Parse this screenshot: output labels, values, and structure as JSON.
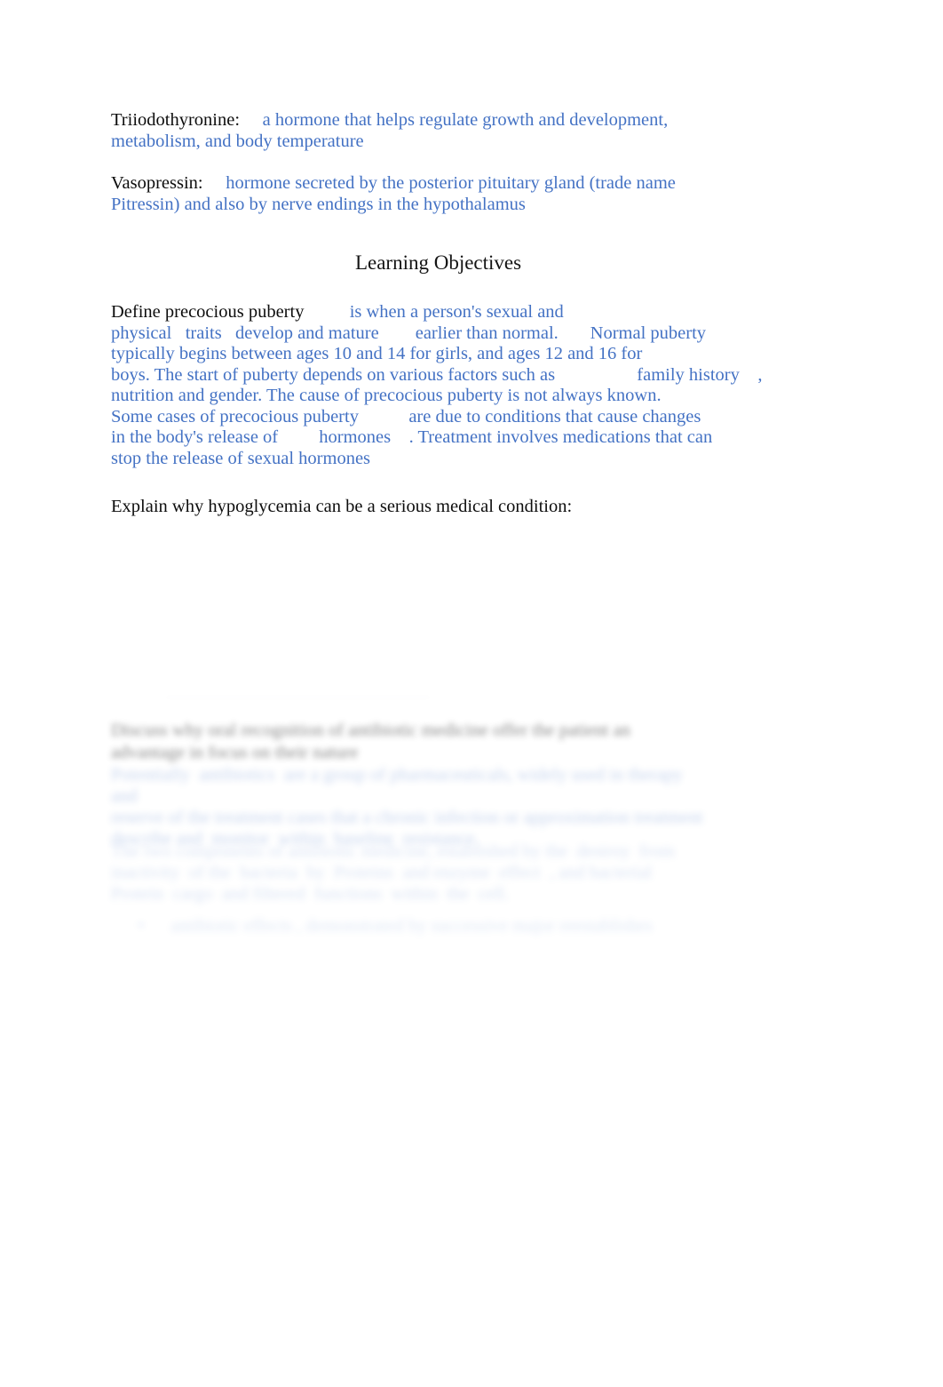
{
  "document": {
    "page_background": "#ffffff",
    "body_text_color": "#4472c4",
    "label_text_color": "#0d0d0d"
  },
  "glossary": [
    {
      "term": "Triiodothyronine:",
      "definition": "     a hormone that helps regulate growth and development,\nmetabolism, and body temperature"
    },
    {
      "term": "Vasopressin:",
      "definition": "     hormone secreted by the posterior pituitary gland (trade name\nPitressin) and also by nerve endings in the hypothalamus"
    }
  ],
  "section": {
    "heading": "Learning Objectives"
  },
  "objectives": [
    {
      "prompt": "Define precocious puberty",
      "answer": "          is when a person's sexual and\nphysical   traits   develop and mature        earlier than normal.       Normal puberty\ntypically begins between ages 10 and 14 for girls, and ages 12 and 16 for\nboys. The start of puberty depends on various factors such as                  family history    ,\nnutrition and gender. The cause of precocious puberty is not always known.\nSome cases of precocious puberty           are due to conditions that cause changes\nin the body's release of         hormones    . Treatment involves medications that can\nstop the release of sexual hormones"
    },
    {
      "prompt": "Explain why hypoglycemia can be a serious medical condition:",
      "answer": ""
    }
  ],
  "faded_region": {
    "note": "Heavily blurred / faded content — text is not legible in the source image",
    "rule_line": "............................................................................................",
    "obscured_heading": "Discuss why oral recognition of antibiotic medicine offer the patient an\nadvantage in focus on their nature",
    "obscured_paragraph_1": "Potentially  antibiotics  are a group of pharmaceuticals, widely used in therapy  and\nreserve of the treatment cases that a chronic infection or approximation treatment\ndescribe and  monitor  within  baseline  resistance.",
    "obscured_paragraph_2": "The two components of antibiotic medicine, established by the  destroy  from  inactivity  of the  bacteria  by  Proteins  and enzyme  effect  , and bacterial\nProtein  cargo  and filtered  functions  within  the  cell.",
    "obscured_bullet": "antibiotic effects , demonstrated by successive major reestablishes"
  }
}
